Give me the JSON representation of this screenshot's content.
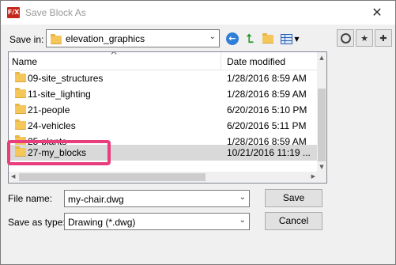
{
  "window": {
    "app_icon_text": "F/X",
    "title": "Save Block As",
    "close_glyph": "✕"
  },
  "toolbar": {
    "save_in_label": "Save in:",
    "save_in_value": "elevation_graphics",
    "back_icon": "back-arrow-icon",
    "up_icon": "up-folder-icon",
    "new_folder_icon": "new-folder-icon",
    "views_icon": "views-menu-icon",
    "find_icon": "find-icon",
    "favorites_icon": "favorites-icon",
    "add_favorite_icon": "add-to-favorites-icon"
  },
  "file_list": {
    "columns": {
      "name": "Name",
      "date": "Date modified"
    },
    "rows": [
      {
        "name": "09-site_structures",
        "date": "1/28/2016 8:59 AM"
      },
      {
        "name": "11-site_lighting",
        "date": "1/28/2016 8:59 AM"
      },
      {
        "name": "21-people",
        "date": "6/20/2016 5:10 PM"
      },
      {
        "name": "24-vehicles",
        "date": "6/20/2016 5:11 PM"
      },
      {
        "name": "25-plants",
        "date": "1/28/2016 8:59 AM"
      },
      {
        "name": "27-my_blocks",
        "date": "10/21/2016 11:19 ...",
        "selected": true
      }
    ]
  },
  "form": {
    "file_name_label": "File name:",
    "file_name_value": "my-chair.dwg",
    "file_type_label": "Save as type:",
    "file_type_value": "Drawing (*.dwg)",
    "save_button": "Save",
    "cancel_button": "Cancel"
  },
  "colors": {
    "highlight": "#e83e7d",
    "folder": "#f5c75b",
    "selection": "#d9d9d9"
  }
}
